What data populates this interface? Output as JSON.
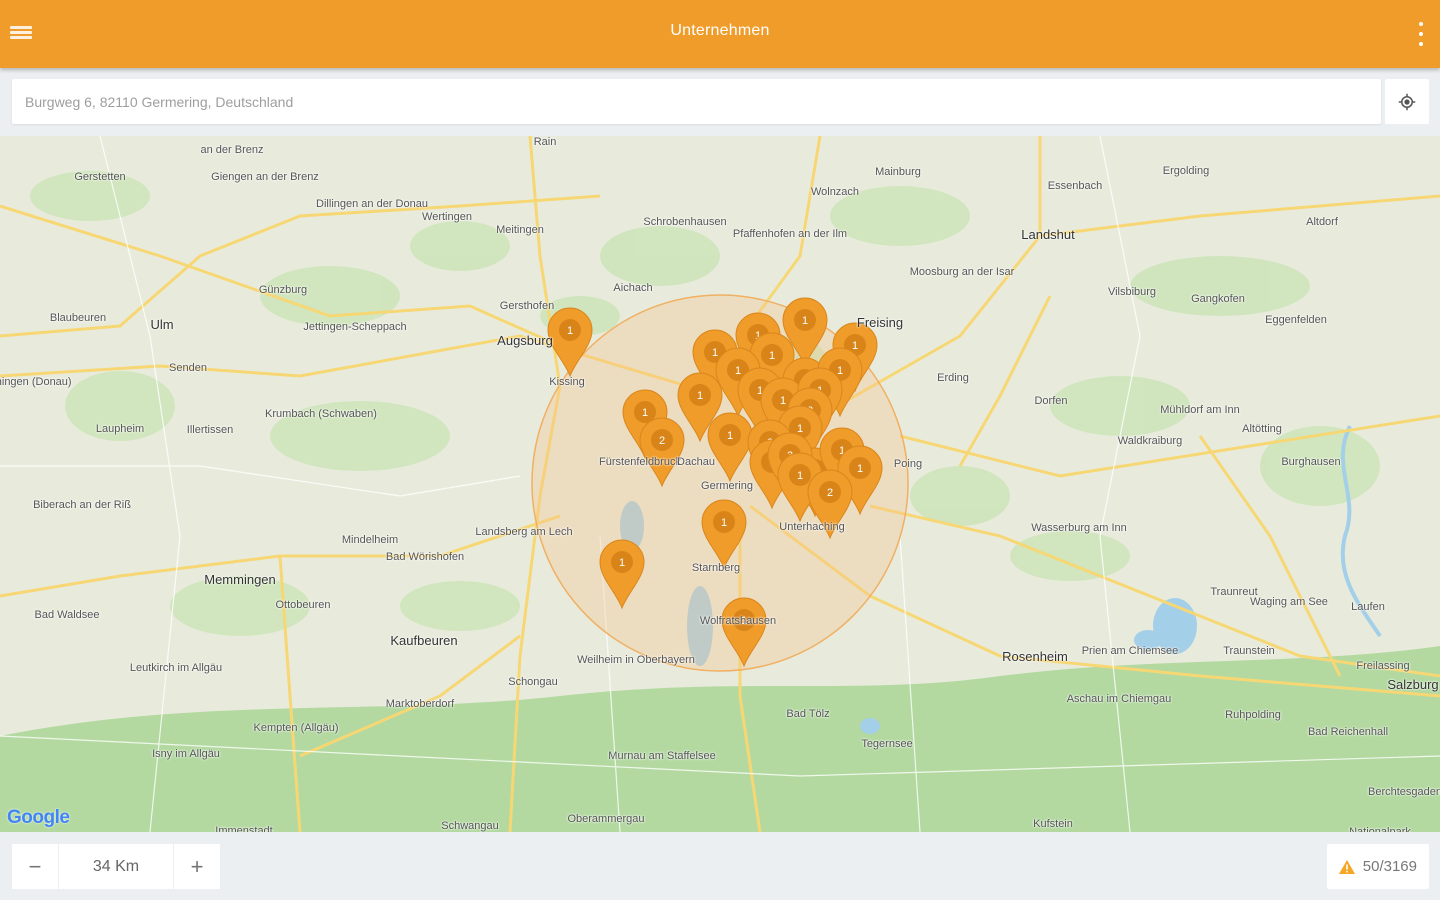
{
  "appbar": {
    "title": "Unternehmen",
    "menu_icon": "hamburger-menu-icon",
    "more_icon": "more-vertical-icon",
    "color": "#f09c2a"
  },
  "search": {
    "value": "Burgweg 6, 82110 Germering, Deutschland",
    "locate_icon": "my-location-icon"
  },
  "map": {
    "attribution": "Google",
    "radius_circle_color": "#f5c48b",
    "places": [
      {
        "name": "an der Brenz"
      },
      {
        "name": "Gerstetten"
      },
      {
        "name": "Giengen an der Brenz"
      },
      {
        "name": "Dillingen an der Donau"
      },
      {
        "name": "Wertingen"
      },
      {
        "name": "Meitingen"
      },
      {
        "name": "Rain"
      },
      {
        "name": "Schrobenhausen"
      },
      {
        "name": "Pfaffenhofen an der Ilm"
      },
      {
        "name": "Wolnzach"
      },
      {
        "name": "Mainburg"
      },
      {
        "name": "Essenbach"
      },
      {
        "name": "Ergolding"
      },
      {
        "name": "Landshut"
      },
      {
        "name": "Altdorf"
      },
      {
        "name": "Ulm"
      },
      {
        "name": "Günzburg"
      },
      {
        "name": "Jettingen-Scheppach"
      },
      {
        "name": "Gersthofen"
      },
      {
        "name": "Augsburg"
      },
      {
        "name": "Aichach"
      },
      {
        "name": "Moosburg an der Isar"
      },
      {
        "name": "Freising"
      },
      {
        "name": "Vilsbiburg"
      },
      {
        "name": "Gangkofen"
      },
      {
        "name": "Eggenfelden"
      },
      {
        "name": "Blaubeuren"
      },
      {
        "name": "Senden"
      },
      {
        "name": "Kissing"
      },
      {
        "name": "Erding"
      },
      {
        "name": "Dorfen"
      },
      {
        "name": "Mühldorf am Inn"
      },
      {
        "name": "Altötting"
      },
      {
        "name": "Ehingen (Donau)"
      },
      {
        "name": "Laupheim"
      },
      {
        "name": "Illertissen"
      },
      {
        "name": "Krumbach (Schwaben)"
      },
      {
        "name": "Waldkraiburg"
      },
      {
        "name": "Burghausen"
      },
      {
        "name": "Biberach an der Riß"
      },
      {
        "name": "Landsberg am Lech"
      },
      {
        "name": "Mindelheim"
      },
      {
        "name": "Bad Wörishofen"
      },
      {
        "name": "Poing"
      },
      {
        "name": "Wasserburg am Inn"
      },
      {
        "name": "Memmingen"
      },
      {
        "name": "Ottobeuren"
      },
      {
        "name": "Starnberg"
      },
      {
        "name": "Bad Waldsee"
      },
      {
        "name": "Kaufbeuren"
      },
      {
        "name": "Traunreut"
      },
      {
        "name": "Waging am See"
      },
      {
        "name": "Laufen"
      },
      {
        "name": "Leutkirch im Allgäu"
      },
      {
        "name": "Weilheim in Oberbayern"
      },
      {
        "name": "Rosenheim"
      },
      {
        "name": "Prien am Chiemsee"
      },
      {
        "name": "Traunstein"
      },
      {
        "name": "Freilassing"
      },
      {
        "name": "Salzburg"
      },
      {
        "name": "Schongau"
      },
      {
        "name": "Marktoberdorf"
      },
      {
        "name": "Aschau im Chiemgau"
      },
      {
        "name": "Ruhpolding"
      },
      {
        "name": "Bad Reichenhall"
      },
      {
        "name": "Kempten (Allgäu)"
      },
      {
        "name": "Isny im Allgäu"
      },
      {
        "name": "Bad Tölz"
      },
      {
        "name": "Tegernsee"
      },
      {
        "name": "Murnau am Staffelsee"
      },
      {
        "name": "Oberammergau"
      },
      {
        "name": "Schwangau"
      },
      {
        "name": "Immenstadt"
      },
      {
        "name": "Kufstein"
      },
      {
        "name": "Berchtesgaden"
      },
      {
        "name": "Nationalpark"
      },
      {
        "name": "Fürstenfeldbruck"
      },
      {
        "name": "Dachau"
      },
      {
        "name": "Germering"
      },
      {
        "name": "Wolfratshausen"
      },
      {
        "name": "Unterhaching"
      }
    ],
    "markers": [
      {
        "count": "1"
      },
      {
        "count": "1"
      },
      {
        "count": "1"
      },
      {
        "count": "1"
      },
      {
        "count": "1"
      },
      {
        "count": "1"
      },
      {
        "count": "1"
      },
      {
        "count": "1"
      },
      {
        "count": "1"
      },
      {
        "count": "1"
      },
      {
        "count": "1"
      },
      {
        "count": "1"
      },
      {
        "count": "1"
      },
      {
        "count": "2"
      },
      {
        "count": "1"
      },
      {
        "count": "2"
      },
      {
        "count": "1"
      },
      {
        "count": "1"
      },
      {
        "count": "2"
      },
      {
        "count": "1"
      },
      {
        "count": "1"
      },
      {
        "count": "3"
      },
      {
        "count": "1"
      },
      {
        "count": "1"
      },
      {
        "count": "1"
      },
      {
        "count": "2"
      },
      {
        "count": "1"
      },
      {
        "count": "1"
      },
      {
        "count": "1"
      }
    ]
  },
  "radius": {
    "minus_label": "−",
    "value": "34 Km",
    "plus_label": "+"
  },
  "results": {
    "warning_icon": "warning-icon",
    "count_text": "50/3169",
    "warning_color": "#f5a623"
  }
}
